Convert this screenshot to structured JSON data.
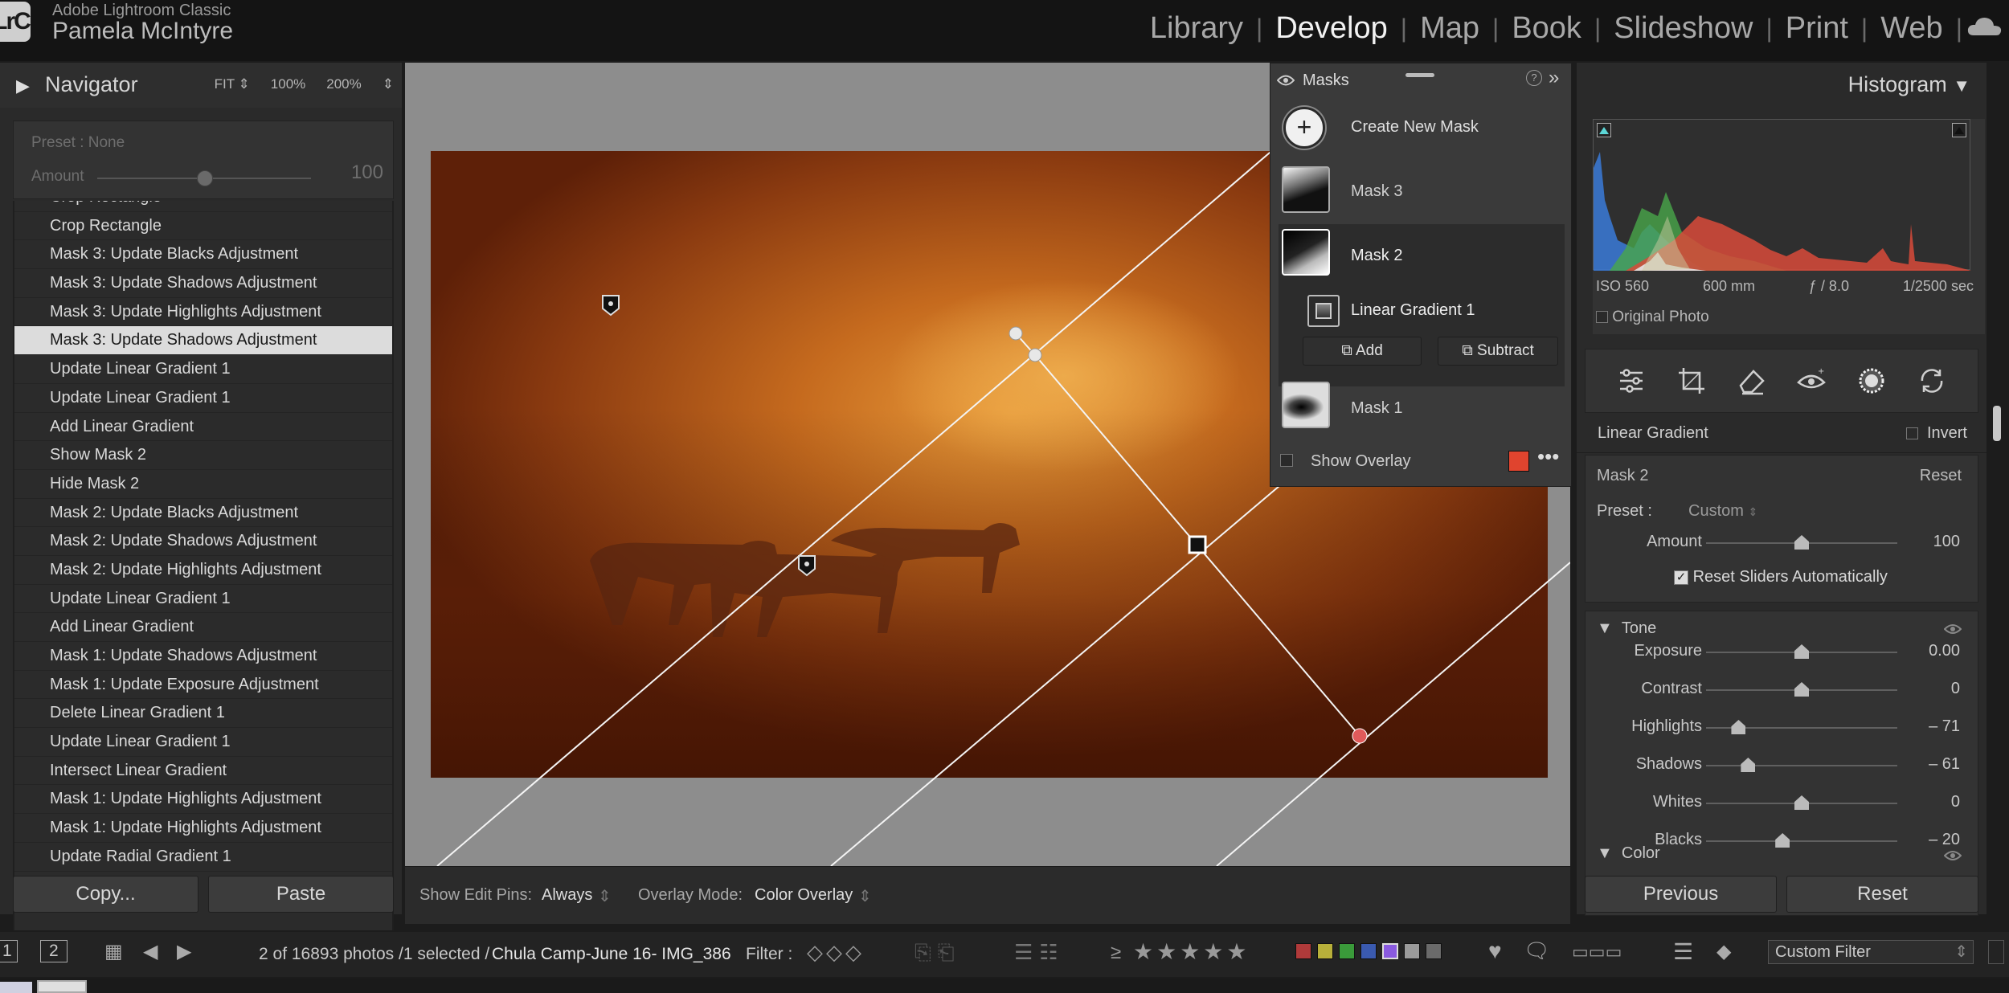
{
  "app": {
    "name": "Adobe Lightroom Classic",
    "user": "Pamela McIntyre",
    "logo": "LrC"
  },
  "modules": [
    "Library",
    "Develop",
    "Map",
    "Book",
    "Slideshow",
    "Print",
    "Web"
  ],
  "active_module": "Develop",
  "navigator": {
    "title": "Navigator",
    "zooms": [
      "FIT ⇕",
      "100%",
      "200%",
      "⇕"
    ]
  },
  "preset": {
    "label": "Preset : None",
    "amount_label": "Amount",
    "amount_value": "100",
    "amount_fraction": 0.54
  },
  "history": [
    "Crop Rectangle",
    "Crop Rectangle",
    "Mask 3: Update Blacks Adjustment",
    "Mask 3: Update Shadows Adjustment",
    "Mask 3: Update Highlights Adjustment",
    "Mask 3: Update Shadows Adjustment",
    "Update Linear Gradient 1",
    "Update Linear Gradient 1",
    "Add Linear Gradient",
    "Show Mask 2",
    "Hide Mask 2",
    "Mask 2: Update Blacks Adjustment",
    "Mask 2: Update Shadows Adjustment",
    "Mask 2: Update Highlights Adjustment",
    "Update Linear Gradient 1",
    "Add Linear Gradient",
    "Mask 1: Update Shadows Adjustment",
    "Mask 1: Update Exposure Adjustment",
    "Delete Linear Gradient 1",
    "Update Linear Gradient 1",
    "Intersect Linear Gradient",
    "Mask 1: Update Highlights Adjustment",
    "Mask 1: Update Highlights Adjustment",
    "Update Radial Gradient 1"
  ],
  "history_selected_index": 5,
  "left_buttons": {
    "copy": "Copy...",
    "paste": "Paste"
  },
  "toolbar": {
    "pins_label": "Show Edit Pins:",
    "pins_value": "Always",
    "overlay_label": "Overlay Mode:",
    "overlay_value": "Color Overlay"
  },
  "masks_panel": {
    "title": "Masks",
    "create": "Create New Mask",
    "masks": [
      "Mask 3",
      "Mask 2",
      "Mask 1"
    ],
    "selected_mask": "Mask 2",
    "component": "Linear Gradient 1",
    "add": "Add",
    "subtract": "Subtract",
    "show_overlay": "Show Overlay",
    "overlay_color": "#e0442e"
  },
  "histogram": {
    "title": "Histogram",
    "iso": "ISO 560",
    "focal": "600 mm",
    "aperture": "ƒ / 8.0",
    "shutter": "1/2500 sec",
    "original_photo": "Original Photo"
  },
  "mask_settings": {
    "type": "Linear Gradient",
    "invert": "Invert",
    "mask_name": "Mask 2",
    "reset": "Reset",
    "preset_label": "Preset :",
    "preset_value": "Custom",
    "amount_label": "Amount",
    "amount_value": "100",
    "reset_sliders": "Reset Sliders Automatically"
  },
  "tone": {
    "title": "Tone",
    "sliders": [
      {
        "label": "Exposure",
        "value": "0.00",
        "pos": 0.5
      },
      {
        "label": "Contrast",
        "value": "0",
        "pos": 0.5
      },
      {
        "label": "Highlights",
        "value": "– 71",
        "pos": 0.17
      },
      {
        "label": "Shadows",
        "value": "– 61",
        "pos": 0.22
      },
      {
        "label": "Whites",
        "value": "0",
        "pos": 0.5
      },
      {
        "label": "Blacks",
        "value": "– 20",
        "pos": 0.4
      }
    ]
  },
  "color_section": "Color",
  "right_buttons": {
    "previous": "Previous",
    "reset": "Reset"
  },
  "filmstrip": {
    "page1": "1",
    "page2": "2",
    "info": "2 of 16893 photos /1 selected /",
    "filename": "Chula Camp-June  16- IMG_386",
    "filter_label": "Filter :",
    "custom_filter": "Custom Filter",
    "rating_prefix": "≥",
    "label_colors": [
      "#b03a3a",
      "#b8b03a",
      "#3a9a3a",
      "#3a5ab0",
      "#8a5ae0",
      "#9a9a9a",
      "#6a6a6a"
    ]
  },
  "colors": {
    "accent": "#ffffff",
    "pin_red": "#e05a5a"
  }
}
